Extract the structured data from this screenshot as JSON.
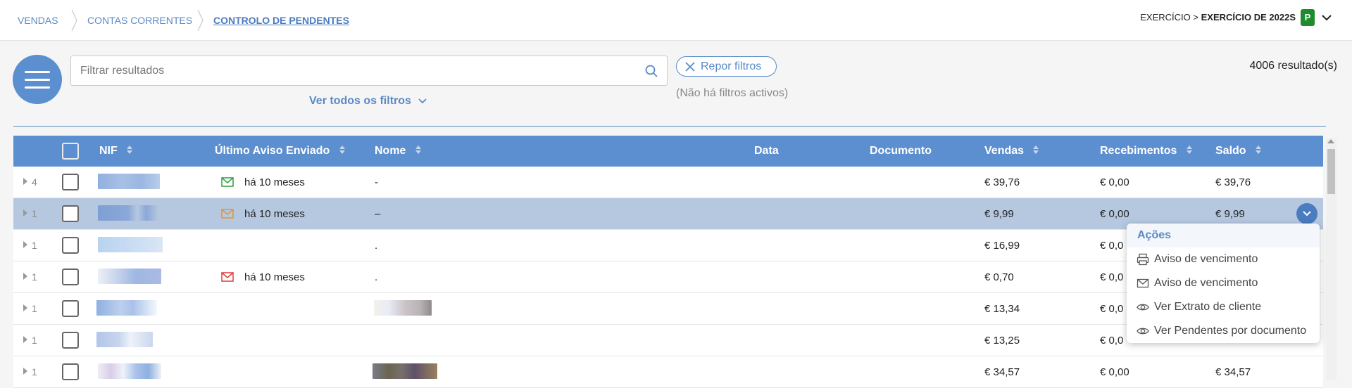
{
  "breadcrumb": {
    "items": [
      "VENDAS",
      "CONTAS CORRENTES",
      "CONTROLO DE PENDENTES"
    ]
  },
  "exercise": {
    "prefix": "EXERCÍCIO >",
    "value": "EXERCÍCIO DE 2022S",
    "badge": "P"
  },
  "filters": {
    "search_placeholder": "Filtrar resultados",
    "all_filters_label": "Ver todos os filtros",
    "reset_label": "Repor filtros",
    "no_active": "(Não há filtros activos)",
    "results_count": "4006 resultado(s)"
  },
  "table": {
    "headers": {
      "nif": "NIF",
      "last_notice": "Último Aviso Enviado",
      "name": "Nome",
      "date": "Data",
      "document": "Documento",
      "sales": "Vendas",
      "receipts": "Recebimentos",
      "balance": "Saldo"
    },
    "rows": [
      {
        "count": "4",
        "notice": "há 10 meses",
        "notice_color": "#2e9e3e",
        "name": "-",
        "sales": "€ 39,76",
        "receipts": "€ 0,00",
        "balance": "€ 39,76"
      },
      {
        "count": "1",
        "notice": "há 10 meses",
        "notice_color": "#e8912c",
        "name": "–",
        "sales": "€ 9,99",
        "receipts": "€ 0,00",
        "balance": "€ 9,99"
      },
      {
        "count": "1",
        "notice": "",
        "notice_color": "",
        "name": ".",
        "sales": "€ 16,99",
        "receipts": "€ 0,0",
        "balance": ""
      },
      {
        "count": "1",
        "notice": "há 10 meses",
        "notice_color": "#e03c3c",
        "name": ".",
        "sales": "€ 0,70",
        "receipts": "€ 0,0",
        "balance": ""
      },
      {
        "count": "1",
        "notice": "",
        "notice_color": "",
        "name": "",
        "sales": "€ 13,34",
        "receipts": "€ 0,0",
        "balance": ""
      },
      {
        "count": "1",
        "notice": "",
        "notice_color": "",
        "name": "",
        "sales": "€ 13,25",
        "receipts": "€ 0,0",
        "balance": ""
      },
      {
        "count": "1",
        "notice": "",
        "notice_color": "",
        "name": "",
        "sales": "€ 34,57",
        "receipts": "€ 0,00",
        "balance": "€ 34,57"
      }
    ]
  },
  "actions_menu": {
    "title": "Ações",
    "items": [
      {
        "label": "Aviso de vencimento",
        "icon": "printer-icon"
      },
      {
        "label": "Aviso de vencimento",
        "icon": "envelope-icon"
      },
      {
        "label": "Ver Extrato de cliente",
        "icon": "eye-icon"
      },
      {
        "label": "Ver Pendentes por documento",
        "icon": "eye-icon"
      }
    ]
  },
  "colors": {
    "accent": "#5b8fd0",
    "link": "#5a8ac6",
    "selected_row": "#b6c8e0",
    "badge_green": "#1e8c2e"
  }
}
